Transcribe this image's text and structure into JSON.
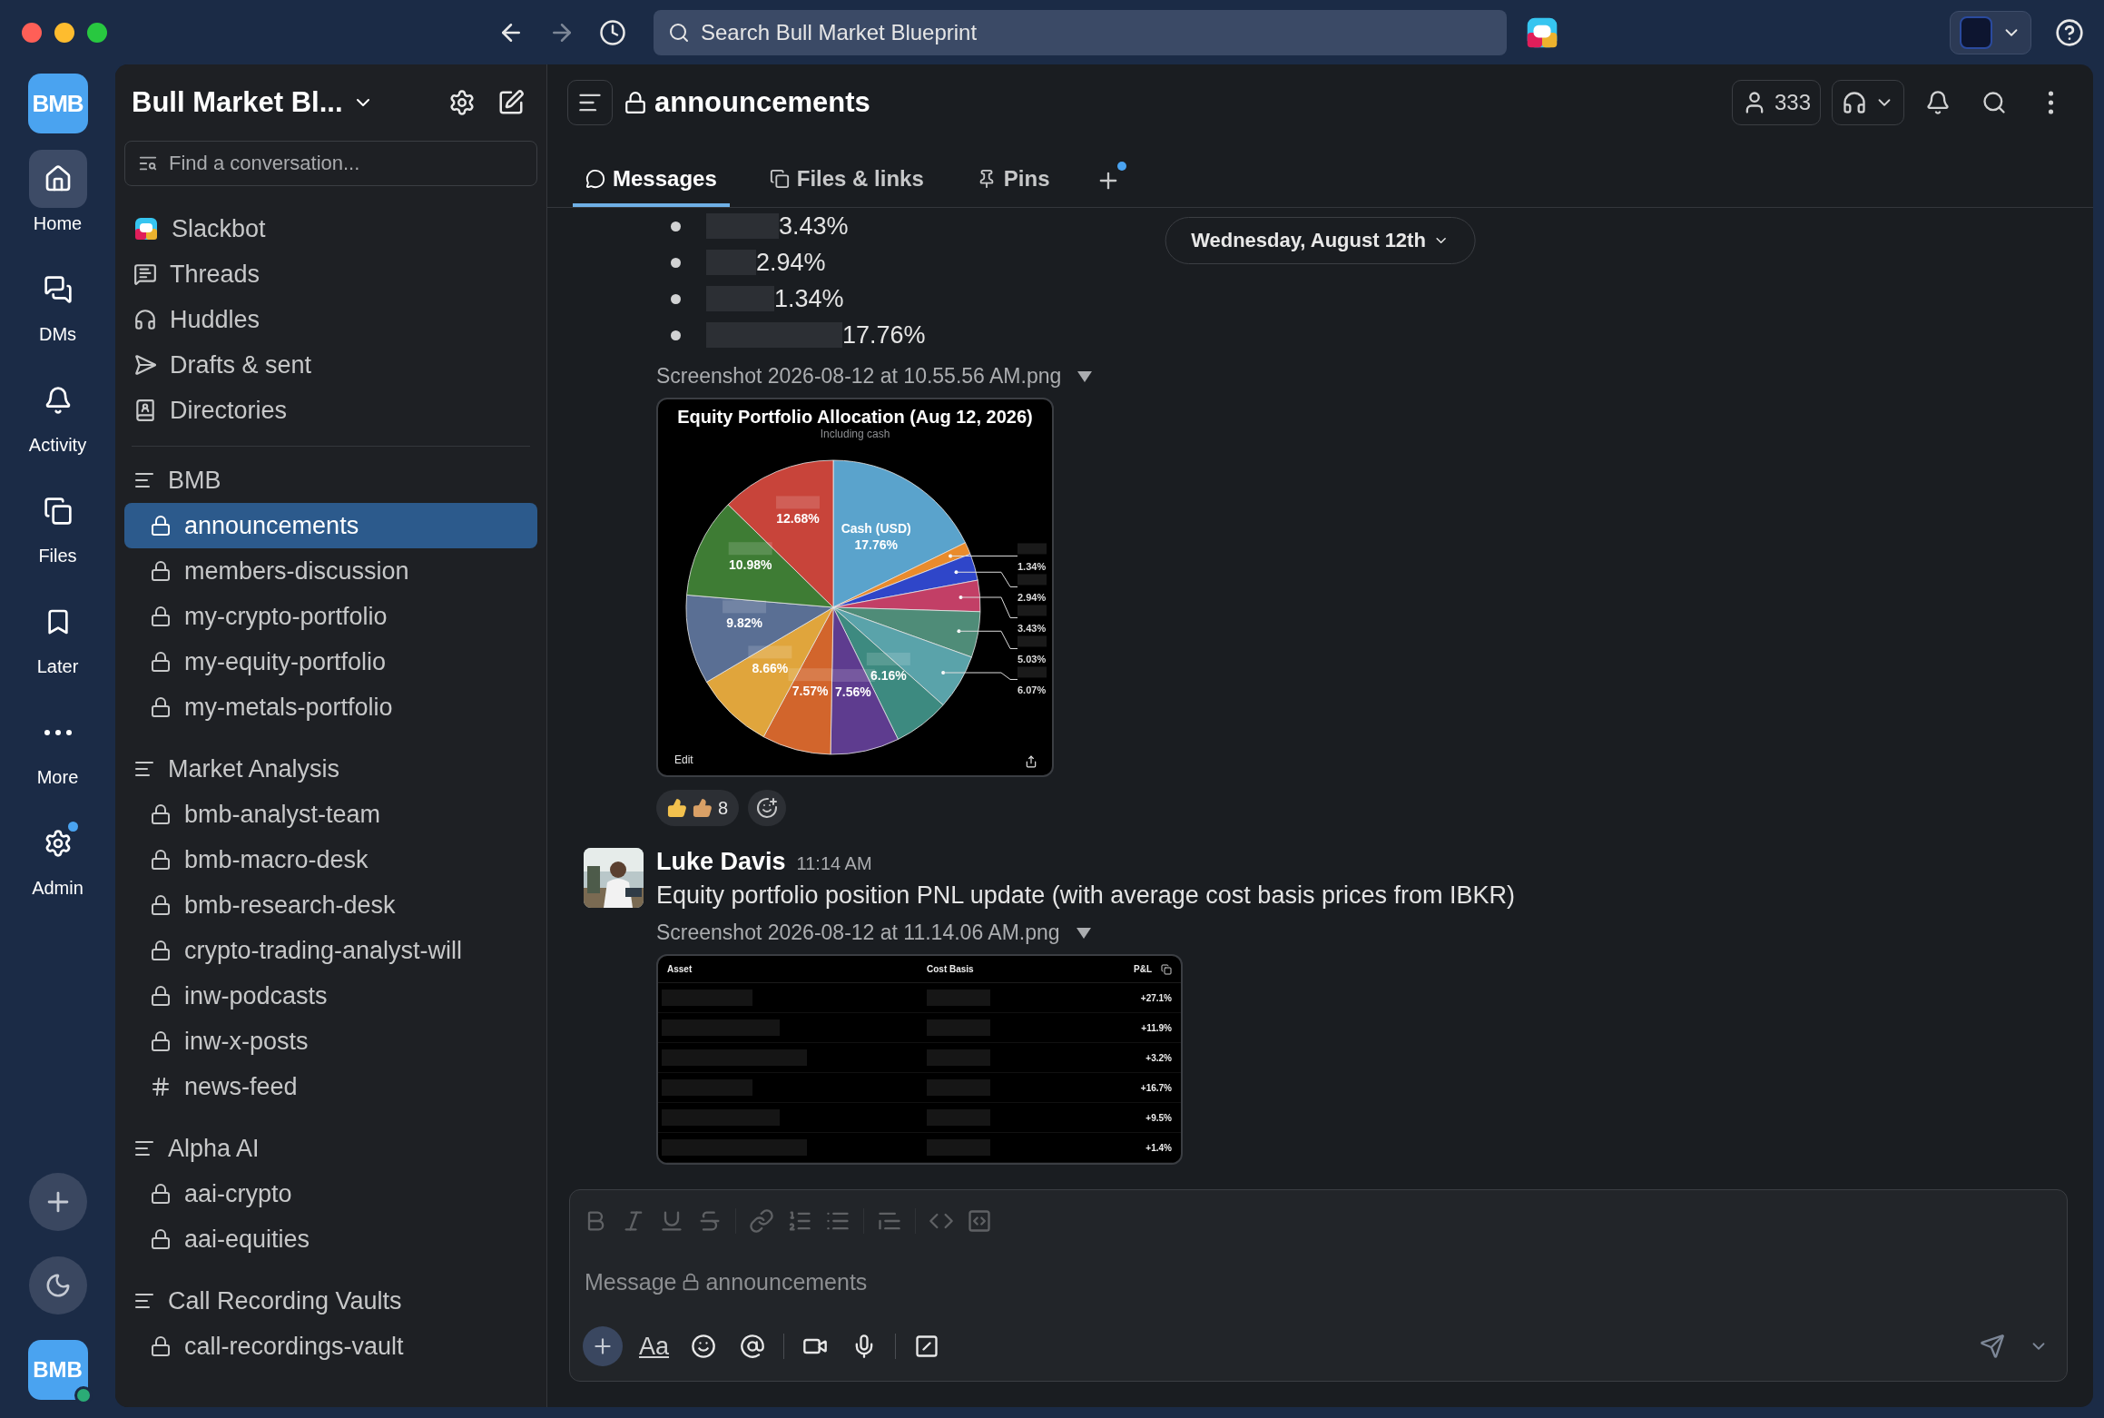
{
  "top_bar": {
    "search": {
      "placeholder": "Search Bull Market Blueprint"
    }
  },
  "rail": {
    "workspace_logo": "BMB",
    "items": [
      {
        "label": "Home",
        "selected": true,
        "badge": false
      },
      {
        "label": "DMs",
        "selected": false,
        "badge": false
      },
      {
        "label": "Activity",
        "selected": false,
        "badge": false
      },
      {
        "label": "Files",
        "selected": false,
        "badge": false
      },
      {
        "label": "Later",
        "selected": false,
        "badge": false
      },
      {
        "label": "More",
        "selected": false,
        "badge": false
      },
      {
        "label": "Admin",
        "selected": false,
        "badge": true
      }
    ],
    "user": {
      "logo": "BMB",
      "online": true
    }
  },
  "sidebar": {
    "workspace": "Bull Market Bl...",
    "search": {
      "placeholder": "Find a conversation..."
    },
    "nav": [
      {
        "label": "Slackbot"
      },
      {
        "label": "Threads"
      },
      {
        "label": "Huddles"
      },
      {
        "label": "Drafts & sent"
      },
      {
        "label": "Directories"
      }
    ],
    "sections": [
      {
        "title": "BMB",
        "channels": [
          {
            "name": "announcements",
            "private": true,
            "selected": true
          },
          {
            "name": "members-discussion",
            "private": true,
            "selected": false
          },
          {
            "name": "my-crypto-portfolio",
            "private": true,
            "selected": false
          },
          {
            "name": "my-equity-portfolio",
            "private": true,
            "selected": false
          },
          {
            "name": "my-metals-portfolio",
            "private": true,
            "selected": false
          }
        ]
      },
      {
        "title": "Market Analysis",
        "channels": [
          {
            "name": "bmb-analyst-team",
            "private": true,
            "selected": false
          },
          {
            "name": "bmb-macro-desk",
            "private": true,
            "selected": false
          },
          {
            "name": "bmb-research-desk",
            "private": true,
            "selected": false
          },
          {
            "name": "crypto-trading-analyst-will",
            "private": true,
            "selected": false
          },
          {
            "name": "inw-podcasts",
            "private": true,
            "selected": false
          },
          {
            "name": "inw-x-posts",
            "private": true,
            "selected": false
          },
          {
            "name": "news-feed",
            "private": false,
            "selected": false
          }
        ]
      },
      {
        "title": "Alpha AI",
        "channels": [
          {
            "name": "aai-crypto",
            "private": true,
            "selected": false
          },
          {
            "name": "aai-equities",
            "private": true,
            "selected": false
          }
        ]
      },
      {
        "title": "Call Recording Vaults",
        "channels": [
          {
            "name": "call-recordings-vault",
            "private": true,
            "selected": false
          }
        ]
      }
    ]
  },
  "channel_header": {
    "name": "announcements",
    "private": true,
    "member_count": "333",
    "add_tab_badge": true,
    "tabs": [
      {
        "label": "Messages",
        "selected": true
      },
      {
        "label": "Files & links",
        "selected": false
      },
      {
        "label": "Pins",
        "selected": false
      }
    ]
  },
  "date_divider": "Wednesday, August 12th",
  "messages": [
    {
      "kind": "continuation",
      "bullets": [
        "3.43%",
        "2.94%",
        "1.34%",
        "17.76%"
      ],
      "attachment": {
        "filename": "Screenshot 2026-08-12 at 10.55.56 AM.png",
        "kind": "pie",
        "subtitle": "Including cash",
        "edit": "Edit",
        "chart_data": {
          "type": "pie",
          "title": "Equity Portfolio Allocation (Aug 12, 2026)",
          "values": [
            17.76,
            1.34,
            2.94,
            3.43,
            5.03,
            6.07,
            6.16,
            7.56,
            7.57,
            8.66,
            9.82,
            10.98,
            12.68
          ],
          "value_labels": [
            "17.76%",
            "1.34%",
            "2.94%",
            "3.43%",
            "5.03%",
            "6.07%",
            "6.16%",
            "7.56%",
            "7.57%",
            "8.66%",
            "9.82%",
            "10.98%",
            "12.68%"
          ],
          "annotations": [
            "Cash (USD)"
          ]
        }
      },
      "reactions": [
        {
          "count": "8"
        }
      ]
    },
    {
      "kind": "message",
      "author": "Luke Davis",
      "time": "11:14 AM",
      "text": "Equity portfolio position PNL update (with average cost basis prices from IBKR)",
      "attachment": {
        "filename": "Screenshot 2026-08-12 at 11.14.06 AM.png",
        "kind": "table",
        "columns": [
          "Asset",
          "Cost Basis",
          "P&L"
        ],
        "rows": [
          "+27.1%",
          "+11.9%",
          "+3.2%",
          "+16.7%",
          "+9.5%",
          "+1.4%"
        ]
      }
    }
  ],
  "composer": {
    "placeholder": "Message",
    "channel": "announcements",
    "format_label": "Aa",
    "formatting_disabled": true
  }
}
